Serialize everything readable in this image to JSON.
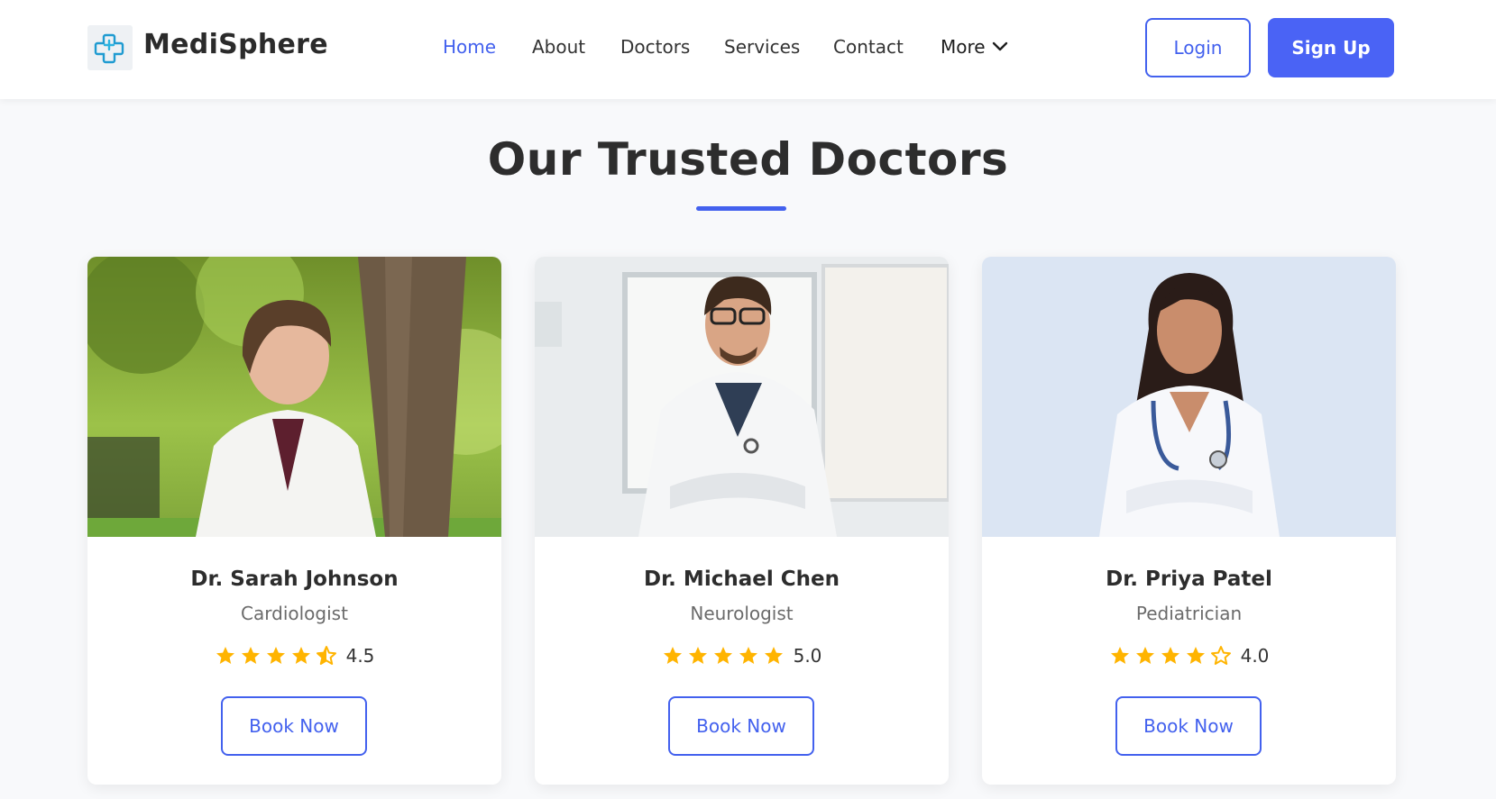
{
  "brand": {
    "name": "MediSphere",
    "logo_icon": "medical-cross-icon",
    "accent_color": "#4361ee"
  },
  "nav": {
    "items": [
      {
        "label": "Home",
        "active": true
      },
      {
        "label": "About",
        "active": false
      },
      {
        "label": "Doctors",
        "active": false
      },
      {
        "label": "Services",
        "active": false
      },
      {
        "label": "Contact",
        "active": false
      }
    ],
    "more_label": "More",
    "more_icon": "chevron-down-icon"
  },
  "auth": {
    "login_label": "Login",
    "signup_label": "Sign Up"
  },
  "section": {
    "title": "Our Trusted Doctors"
  },
  "doctors": [
    {
      "name": "Dr. Sarah Johnson",
      "specialty": "Cardiologist",
      "rating": "4.5",
      "stars": [
        1,
        1,
        1,
        1,
        0.5
      ],
      "book_label": "Book Now",
      "photo": "doctor-photo-woman-outdoors"
    },
    {
      "name": "Dr. Michael Chen",
      "specialty": "Neurologist",
      "rating": "5.0",
      "stars": [
        1,
        1,
        1,
        1,
        1
      ],
      "book_label": "Book Now",
      "photo": "doctor-photo-man-clinic"
    },
    {
      "name": "Dr. Priya Patel",
      "specialty": "Pediatrician",
      "rating": "4.0",
      "stars": [
        1,
        1,
        1,
        1,
        0
      ],
      "book_label": "Book Now",
      "photo": "doctor-photo-woman-studio"
    }
  ],
  "colors": {
    "star": "#ffb400",
    "primary_button": "#4a63f5"
  }
}
